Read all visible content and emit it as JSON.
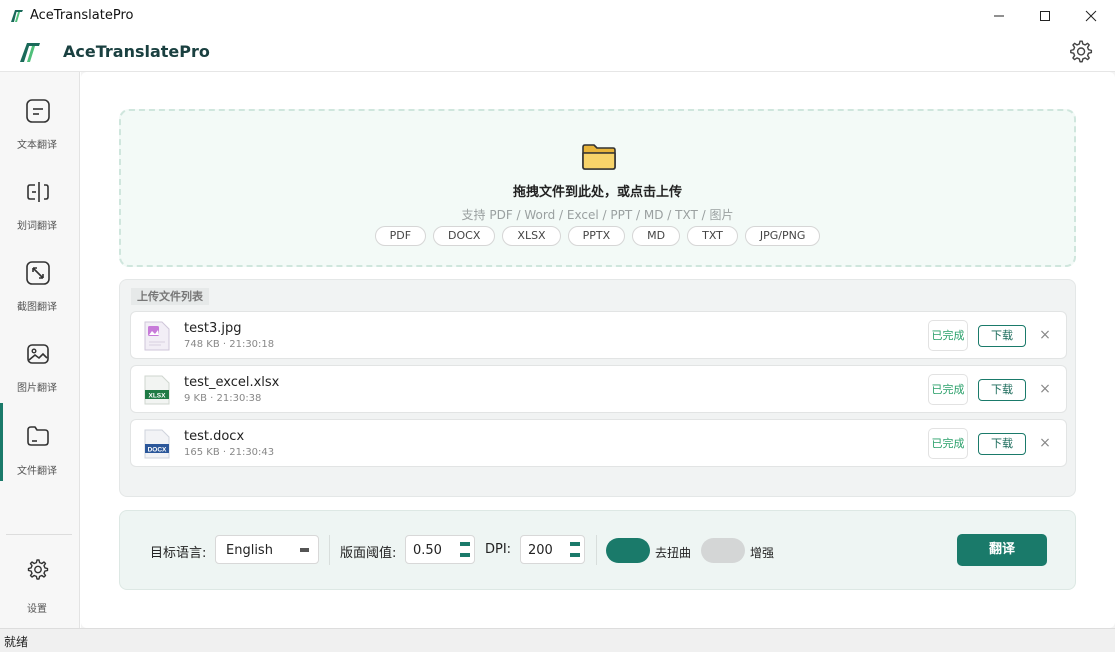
{
  "window": {
    "title": "AceTranslatePro",
    "minimize_icon": "minimize-icon",
    "maximize_icon": "maximize-icon",
    "close_icon": "close-icon"
  },
  "header": {
    "title": "AceTranslatePro",
    "settings_icon": "gear-icon"
  },
  "sidebar": {
    "items": [
      {
        "label": "文本翻译",
        "icon": "text-doc-icon"
      },
      {
        "label": "划词翻译",
        "icon": "text-cursor-icon"
      },
      {
        "label": "截图翻译",
        "icon": "screenshot-expand-icon"
      },
      {
        "label": "图片翻译",
        "icon": "image-icon"
      },
      {
        "label": "文件翻译",
        "icon": "folder-icon"
      }
    ],
    "settings_label": "设置",
    "active_index": 4
  },
  "dropzone": {
    "title": "拖拽文件到此处，或点击上传",
    "subtitle": "支持 PDF / Word / Excel / PPT / MD / TXT / 图片",
    "formats": [
      "PDF",
      "DOCX",
      "XLSX",
      "PPTX",
      "MD",
      "TXT",
      "JPG/PNG"
    ]
  },
  "filelist": {
    "title": "上传文件列表",
    "files": [
      {
        "name": "test3.jpg",
        "meta": "748 KB · 21:30:18",
        "status": "已完成",
        "action": "下载",
        "type": "image",
        "type_tag": ""
      },
      {
        "name": "test_excel.xlsx",
        "meta": "9 KB · 21:30:38",
        "status": "已完成",
        "action": "下载",
        "type": "xlsx",
        "type_tag": "XLSX"
      },
      {
        "name": "test.docx",
        "meta": "165 KB · 21:30:43",
        "status": "已完成",
        "action": "下载",
        "type": "docx",
        "type_tag": "DOCX"
      }
    ],
    "remove_glyph": "×"
  },
  "options": {
    "target_lang_label": "目标语言:",
    "target_lang_value": "English",
    "threshold_label": "版面阈值:",
    "threshold_value": "0.50",
    "dpi_label": "DPI:",
    "dpi_value": "200",
    "deskew_label": "去扭曲",
    "deskew_on": true,
    "enhance_label": "增强",
    "enhance_on": false,
    "translate_label": "翻译"
  },
  "colors": {
    "accent": "#1a7a6a",
    "done_text": "#2aa06a",
    "toggle_off": "#d4d6d6"
  },
  "status_bar": {
    "text": "就绪"
  }
}
